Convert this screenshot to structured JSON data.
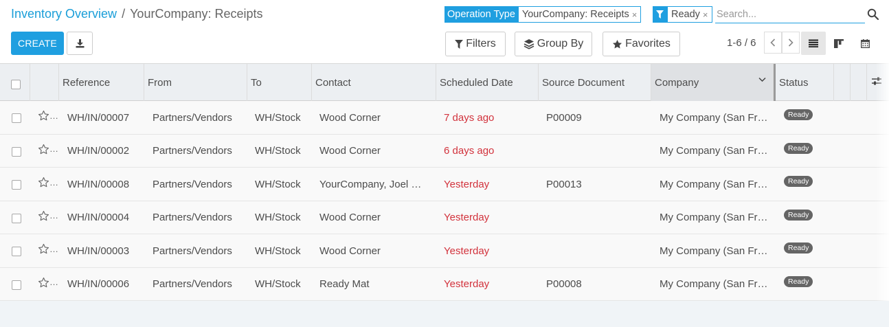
{
  "breadcrumb": {
    "parent": "Inventory Overview",
    "separator": "/",
    "current": "YourCompany: Receipts"
  },
  "toolbar": {
    "create_label": "CREATE",
    "download_icon": "download-icon"
  },
  "search": {
    "facets": [
      {
        "label": "Operation Type",
        "value": "YourCompany: Receipts",
        "remove": "×"
      },
      {
        "label_icon": "filter-icon",
        "value": "Ready",
        "remove": "×"
      }
    ],
    "placeholder": "Search..."
  },
  "search_options": {
    "filters_label": "Filters",
    "group_by_label": "Group By",
    "favorites_label": "Favorites"
  },
  "pager": {
    "value": "1-6 / 6"
  },
  "views": [
    "list-view-icon",
    "kanban-view-icon",
    "calendar-view-icon"
  ],
  "colors": {
    "primary": "#1f9fe0",
    "late_date": "#d2323c",
    "badge": "#656565"
  },
  "table": {
    "columns": [
      "Reference",
      "From",
      "To",
      "Contact",
      "Scheduled Date",
      "Source Document",
      "Company",
      "Status"
    ],
    "rows": [
      {
        "reference": "WH/IN/00007",
        "from": "Partners/Vendors",
        "to": "WH/Stock",
        "contact": "Wood Corner",
        "scheduled_date": "7 days ago",
        "source_document": "P00009",
        "company": "My Company (San Fr…",
        "status": "Ready"
      },
      {
        "reference": "WH/IN/00002",
        "from": "Partners/Vendors",
        "to": "WH/Stock",
        "contact": "Wood Corner",
        "scheduled_date": "6 days ago",
        "source_document": "",
        "company": "My Company (San Fr…",
        "status": "Ready"
      },
      {
        "reference": "WH/IN/00008",
        "from": "Partners/Vendors",
        "to": "WH/Stock",
        "contact": "YourCompany, Joel …",
        "scheduled_date": "Yesterday",
        "source_document": "P00013",
        "company": "My Company (San Fr…",
        "status": "Ready"
      },
      {
        "reference": "WH/IN/00004",
        "from": "Partners/Vendors",
        "to": "WH/Stock",
        "contact": "Wood Corner",
        "scheduled_date": "Yesterday",
        "source_document": "",
        "company": "My Company (San Fr…",
        "status": "Ready"
      },
      {
        "reference": "WH/IN/00003",
        "from": "Partners/Vendors",
        "to": "WH/Stock",
        "contact": "Wood Corner",
        "scheduled_date": "Yesterday",
        "source_document": "",
        "company": "My Company (San Fr…",
        "status": "Ready"
      },
      {
        "reference": "WH/IN/00006",
        "from": "Partners/Vendors",
        "to": "WH/Stock",
        "contact": "Ready Mat",
        "scheduled_date": "Yesterday",
        "source_document": "P00008",
        "company": "My Company (San Fr…",
        "status": "Ready"
      }
    ]
  }
}
